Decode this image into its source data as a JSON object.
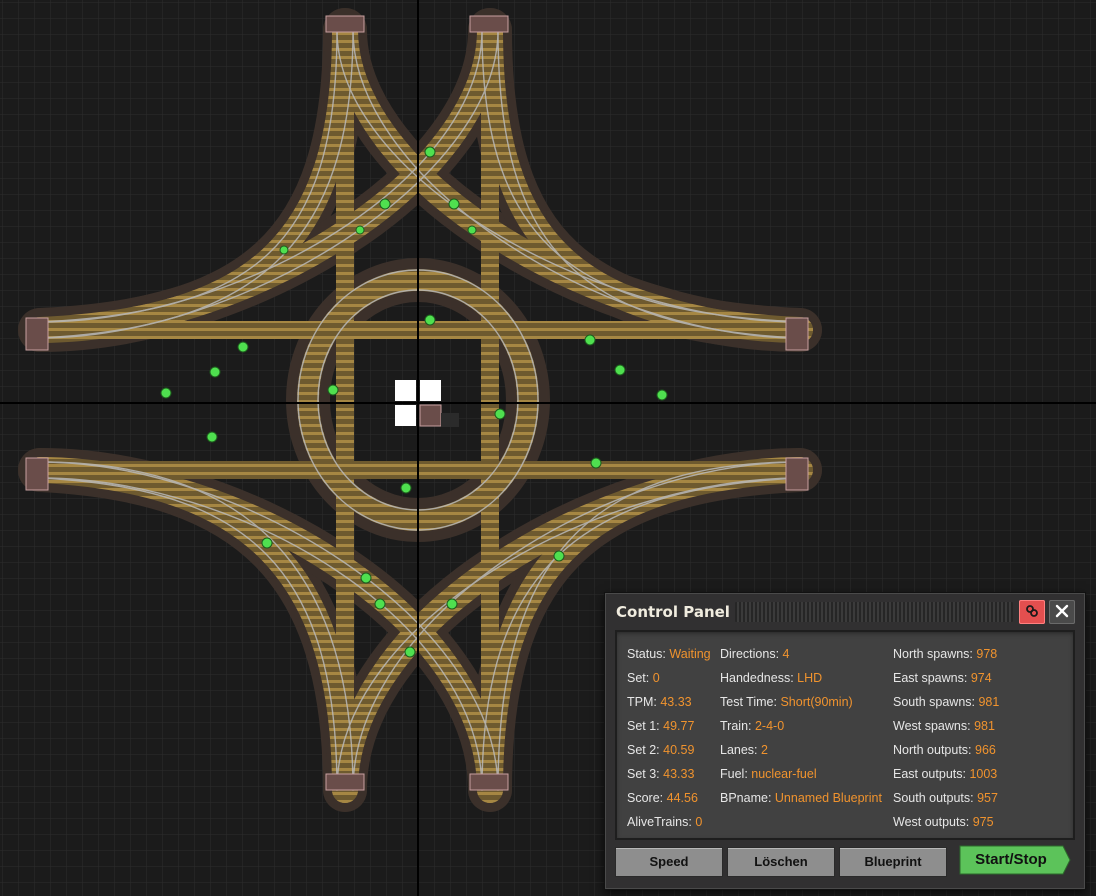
{
  "panel": {
    "title": "Control Panel",
    "col1": [
      {
        "label": "Status:",
        "value": "Waiting"
      },
      {
        "label": "Set:",
        "value": "0"
      },
      {
        "label": "TPM:",
        "value": "43.33"
      },
      {
        "label": "Set 1:",
        "value": "49.77"
      },
      {
        "label": "Set 2:",
        "value": "40.59"
      },
      {
        "label": "Set 3:",
        "value": "43.33"
      },
      {
        "label": "Score:",
        "value": "44.56"
      },
      {
        "label": "AliveTrains:",
        "value": "0"
      }
    ],
    "col2": [
      {
        "label": "Directions:",
        "value": "4"
      },
      {
        "label": "Handedness:",
        "value": "LHD"
      },
      {
        "label": "Test Time:",
        "value": "Short(90min)"
      },
      {
        "label": "Train:",
        "value": "2-4-0"
      },
      {
        "label": "Lanes:",
        "value": "2"
      },
      {
        "label": "Fuel:",
        "value": "nuclear-fuel"
      },
      {
        "label": "BPname:",
        "value": "Unnamed Blueprint"
      }
    ],
    "col3": [
      {
        "label": "North spawns:",
        "value": "978"
      },
      {
        "label": "East spawns:",
        "value": "974"
      },
      {
        "label": "South spawns:",
        "value": "981"
      },
      {
        "label": "West spawns:",
        "value": "981"
      },
      {
        "label": "North outputs:",
        "value": "966"
      },
      {
        "label": "East outputs:",
        "value": "1003"
      },
      {
        "label": "South outputs:",
        "value": "957"
      },
      {
        "label": "West outputs:",
        "value": "975"
      }
    ],
    "buttons": {
      "speed": "Speed",
      "clear": "Löschen",
      "blueprint": "Blueprint",
      "start_stop": "Start/Stop"
    },
    "icons": {
      "pin": "link-icon",
      "close": "close-icon"
    }
  },
  "colors": {
    "value_orange": "#f0932e",
    "start_green": "#5cc35a",
    "pin_red": "#e34f4f",
    "rail_bed": "#7a6538",
    "rail_steel": "#b9b9b9",
    "signal_green": "#4fe04f"
  }
}
